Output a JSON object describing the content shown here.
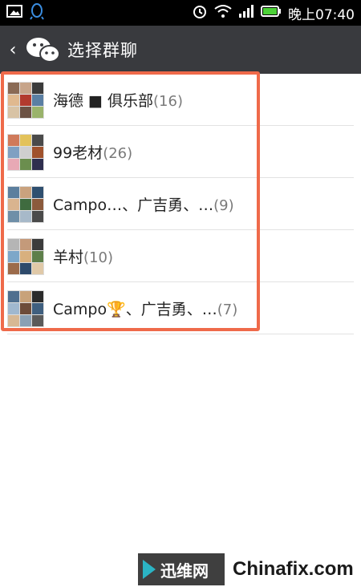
{
  "statusbar": {
    "time": "晚上07:40",
    "icons": [
      "gallery-icon",
      "qq-icon",
      "alarm-icon",
      "wifi-icon",
      "signal-icon",
      "battery-icon"
    ]
  },
  "header": {
    "back_glyph": "‹",
    "title": "选择群聊"
  },
  "groups": [
    {
      "name": "海德 ■ 俱乐部",
      "count": "(16)"
    },
    {
      "name": "99老材",
      "count": "(26)"
    },
    {
      "name": "Campo…、广吉勇、…",
      "count": "(9)"
    },
    {
      "name": "羊村",
      "count": "(10)"
    },
    {
      "name": "Campo🏆、广吉勇、…",
      "count": "(7)"
    }
  ],
  "watermark": {
    "badge": "迅维网",
    "site": "Chinafix.com"
  },
  "colors": {
    "appbar": "#393a3e",
    "highlight": "#ef6a4a",
    "accent": "#2bb4c4"
  }
}
